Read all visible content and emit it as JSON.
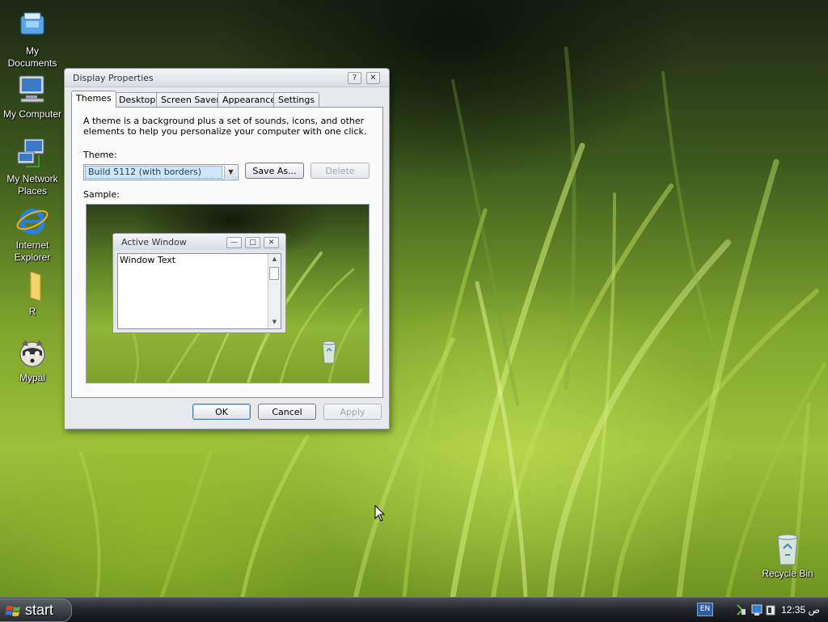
{
  "desktop": {
    "icons": [
      {
        "label": "My Documents",
        "icon": "my-documents-icon"
      },
      {
        "label": "My Computer",
        "icon": "my-computer-icon"
      },
      {
        "label": "My Network Places",
        "icon": "network-places-icon"
      },
      {
        "label": "Internet Explorer",
        "icon": "internet-explorer-icon"
      },
      {
        "label": "R",
        "icon": "folder-icon"
      },
      {
        "label": "Mypal",
        "icon": "mypal-raccoon-icon"
      }
    ],
    "recycle_bin": {
      "label": "Recycle Bin",
      "icon": "recycle-bin-icon"
    }
  },
  "dialog": {
    "title": "Display Properties",
    "help_glyph": "?",
    "close_glyph": "✕",
    "tabs": [
      "Themes",
      "Desktop",
      "Screen Saver",
      "Appearance",
      "Settings"
    ],
    "active_tab": "Themes",
    "description": "A theme is a background plus a set of sounds, icons, and other elements to help you personalize your computer with one click.",
    "theme_label": "Theme:",
    "theme_value": "Build 5112 (with borders)",
    "save_as_label": "Save As...",
    "delete_label": "Delete",
    "sample_label": "Sample:",
    "sample_window": {
      "title": "Active Window",
      "text": "Window Text"
    },
    "ok_label": "OK",
    "cancel_label": "Cancel",
    "apply_label": "Apply"
  },
  "taskbar": {
    "start_label": "start",
    "language": "EN",
    "clock": "12:35 ص"
  },
  "colors": {
    "dialog_bg": "#e8e9ec",
    "selection": "#cfe6f8",
    "taskbar": "#24272c"
  }
}
